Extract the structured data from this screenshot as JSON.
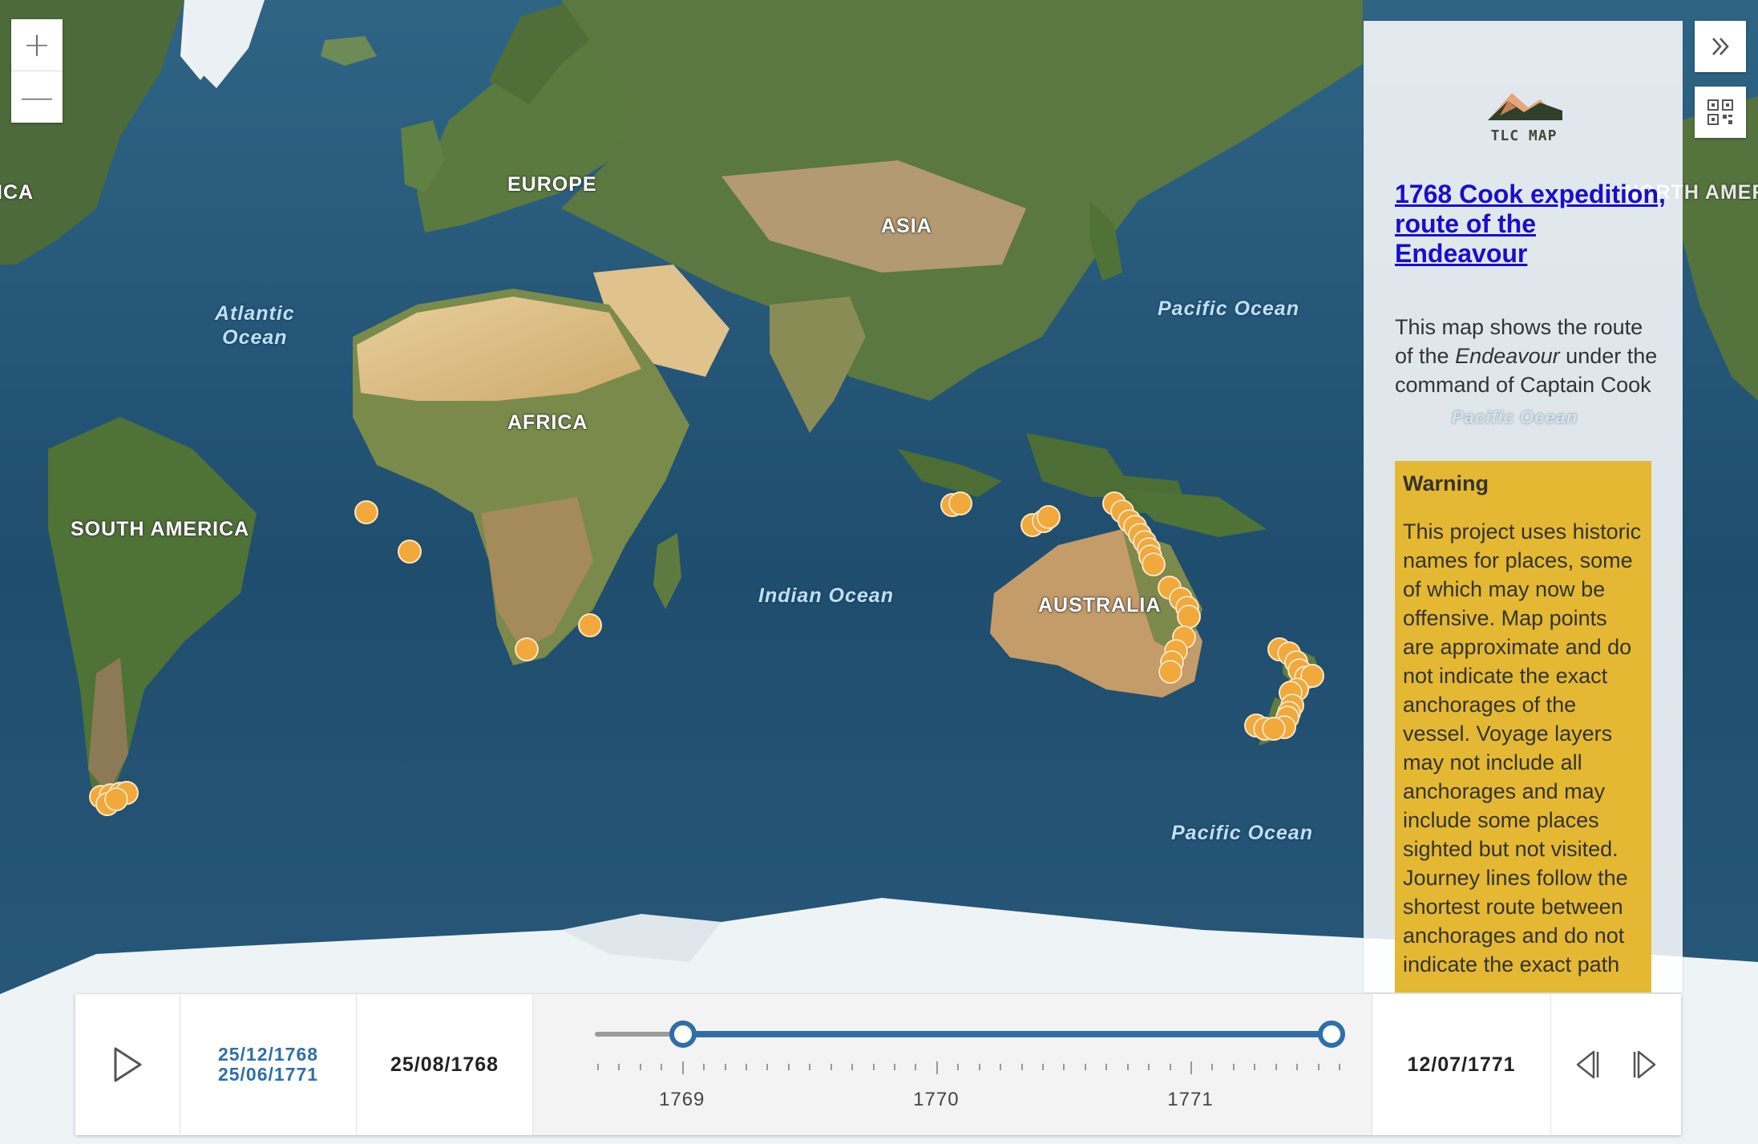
{
  "map": {
    "continents": [
      {
        "id": "europe",
        "label": "EUROPE"
      },
      {
        "id": "asia",
        "label": "ASIA"
      },
      {
        "id": "africa",
        "label": "AFRICA"
      },
      {
        "id": "south_america",
        "label": "SOUTH AMERICA"
      },
      {
        "id": "australia",
        "label": "AUSTRALIA"
      },
      {
        "id": "north_america_left",
        "label": "ICA"
      },
      {
        "id": "north_america_right",
        "label": "NORTH AMER"
      }
    ],
    "oceans": [
      {
        "id": "atlantic",
        "line1": "Atlantic",
        "line2": "Ocean"
      },
      {
        "id": "pacific_north",
        "line1": "Pacific Ocean",
        "line2": ""
      },
      {
        "id": "indian",
        "line1": "Indian Ocean",
        "line2": ""
      },
      {
        "id": "pacific_south",
        "line1": "Pacific Ocean",
        "line2": ""
      },
      {
        "id": "pacific_faded",
        "line1": "Pacific Ocean",
        "line2": ""
      }
    ],
    "marker_color": "#f2a93b",
    "marker_count": 47
  },
  "controls": {
    "zoom_in": "+",
    "zoom_out": "—",
    "expand_icon": "double-chevron-right-icon",
    "qr_icon": "qr-code-icon"
  },
  "panel": {
    "logo_text": "TLC MAP",
    "title": "1768 Cook expedition, route of the Endeavour",
    "desc_prefix": "This map shows the route of the ",
    "desc_italic": "Endeavour",
    "desc_suffix": " under the command of Captain Cook",
    "warning_title": "Warning",
    "warning_body": "This project uses historic names for places, some of which may now be offensive. Map points are approximate and do not indicate the exact anchorages of the vessel. Voyage layers may not include all anchorages and may include some places sighted but not visited. Journey lines follow the shortest route between anchorages and do not indicate the exact path",
    "accent_color": "#e4b832",
    "link_color": "#1a0dcc"
  },
  "timeslider": {
    "range_start": "25/12/1768",
    "range_end": "25/06/1771",
    "full_start": "25/08/1768",
    "full_end": "12/07/1771",
    "year_labels": [
      "1769",
      "1770",
      "1771"
    ],
    "selected_start_fraction": 0.116,
    "selected_end_fraction": 0.99,
    "accent_color": "#2e6fa8"
  }
}
